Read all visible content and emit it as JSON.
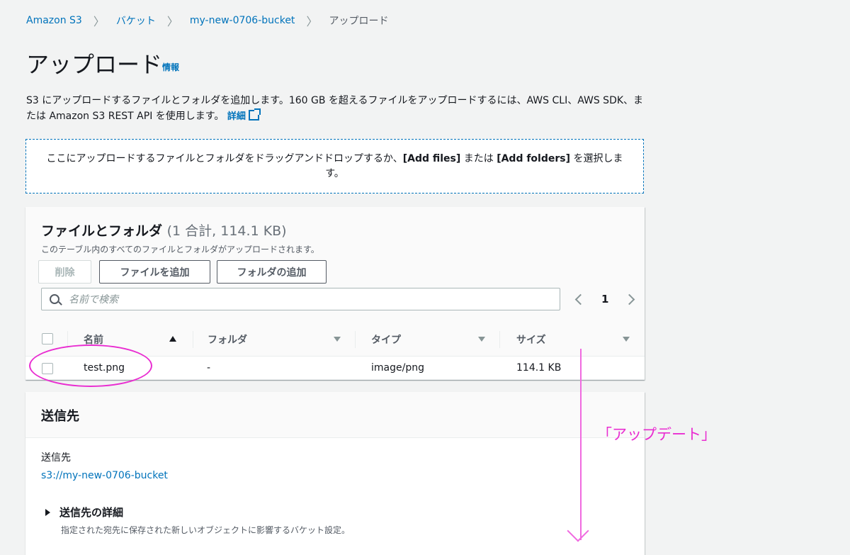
{
  "breadcrumb": {
    "items": [
      "Amazon S3",
      "バケット",
      "my-new-0706-bucket"
    ],
    "current": "アップロード"
  },
  "header": {
    "title": "アップロード",
    "info_link": "情報"
  },
  "description": {
    "text": "S3 にアップロードするファイルとフォルダを追加します。160 GB を超えるファイルをアップロードするには、AWS CLI、AWS SDK、または Amazon S3 REST API を使用します。",
    "link": "詳細"
  },
  "dropzone": {
    "prefix": "ここにアップロードするファイルとフォルダをドラッグアンドドロップするか、",
    "add_files": "[Add files]",
    "middle": " または ",
    "add_folders": "[Add folders]",
    "suffix": " を選択します。"
  },
  "files_panel": {
    "title": "ファイルとフォルダ",
    "count": "(1 合計, 114.1 KB)",
    "subtitle": "このテーブル内のすべてのファイルとフォルダがアップロードされます。",
    "delete_button": "削除",
    "add_files_button": "ファイルを追加",
    "add_folder_button": "フォルダの追加",
    "search_placeholder": "名前で検索",
    "page": "1",
    "columns": [
      "名前",
      "フォルダ",
      "タイプ",
      "サイズ"
    ],
    "rows": [
      {
        "name": "test.png",
        "folder": "-",
        "type": "image/png",
        "size": "114.1 KB"
      }
    ]
  },
  "destination": {
    "title": "送信先",
    "label": "送信先",
    "value": "s3://my-new-0706-bucket",
    "details_title": "送信先の詳細",
    "details_sub": "指定された宛先に保存された新しいオブジェクトに影響するバケット設定。"
  },
  "annotation": {
    "text": "「アップデート」",
    "color": "#e92dd1"
  }
}
